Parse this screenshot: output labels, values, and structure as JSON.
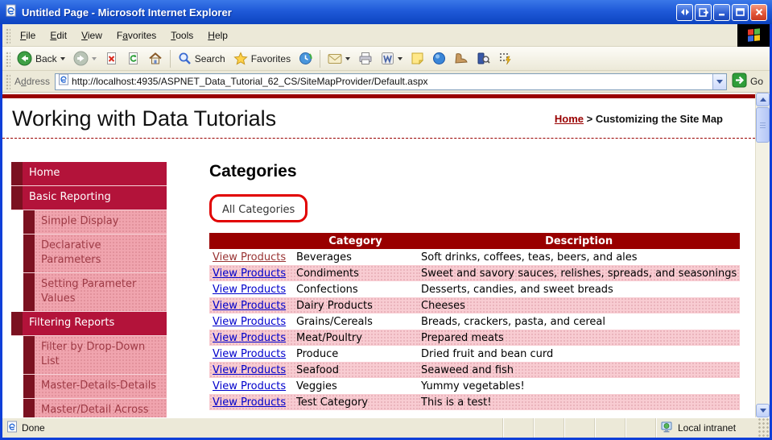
{
  "window": {
    "title": "Untitled Page - Microsoft Internet Explorer"
  },
  "menu": {
    "items": [
      {
        "label": "File"
      },
      {
        "label": "Edit"
      },
      {
        "label": "View"
      },
      {
        "label": "Favorites"
      },
      {
        "label": "Tools"
      },
      {
        "label": "Help"
      }
    ]
  },
  "toolbar": {
    "back_label": "Back",
    "search_label": "Search",
    "favorites_label": "Favorites"
  },
  "address": {
    "label": "Address",
    "url": "http://localhost:4935/ASPNET_Data_Tutorial_62_CS/SiteMapProvider/Default.aspx",
    "go_label": "Go"
  },
  "page": {
    "title": "Working with Data Tutorials",
    "breadcrumb": {
      "home": "Home",
      "separator": ">",
      "current": "Customizing the Site Map"
    },
    "sidebar": {
      "items": [
        {
          "label": "Home",
          "level": 1
        },
        {
          "label": "Basic Reporting",
          "level": 1
        },
        {
          "label": "Simple Display",
          "level": 2
        },
        {
          "label": "Declarative Parameters",
          "level": 2
        },
        {
          "label": "Setting Parameter Values",
          "level": 2
        },
        {
          "label": "Filtering Reports",
          "level": 1
        },
        {
          "label": "Filter by Drop-Down List",
          "level": 2
        },
        {
          "label": "Master-Details-Details",
          "level": 2
        },
        {
          "label": "Master/Detail Across Two Pages",
          "level": 2
        }
      ]
    },
    "main": {
      "heading": "Categories",
      "filter_label": "All Categories",
      "table": {
        "headers": [
          "",
          "Category",
          "Description"
        ],
        "link_label": "View Products",
        "rows": [
          {
            "category": "Beverages",
            "description": "Soft drinks, coffees, teas, beers, and ales"
          },
          {
            "category": "Condiments",
            "description": "Sweet and savory sauces, relishes, spreads, and seasonings"
          },
          {
            "category": "Confections",
            "description": "Desserts, candies, and sweet breads"
          },
          {
            "category": "Dairy Products",
            "description": "Cheeses"
          },
          {
            "category": "Grains/Cereals",
            "description": "Breads, crackers, pasta, and cereal"
          },
          {
            "category": "Meat/Poultry",
            "description": "Prepared meats"
          },
          {
            "category": "Produce",
            "description": "Dried fruit and bean curd"
          },
          {
            "category": "Seafood",
            "description": "Seaweed and fish"
          },
          {
            "category": "Veggies",
            "description": "Yummy vegetables!"
          },
          {
            "category": "Test Category",
            "description": "This is a test!"
          }
        ]
      }
    }
  },
  "statusbar": {
    "status": "Done",
    "zone": "Local intranet"
  },
  "colors": {
    "maroon": "#990000",
    "nav_crimson": "#b3133a",
    "nav_notch": "#7b1120",
    "nav_pink": "#f0a4ae",
    "row_pink": "#f8ccd2",
    "link_blue": "#0000cc",
    "visited_link": "#993333",
    "annotation_red": "#e10000",
    "titlebar_blue": "#1f5ad8",
    "chrome_tan": "#ece9d8"
  },
  "icons": {
    "titlebar": "ie-page-icon",
    "back": "green-circle-left-arrow",
    "forward": "gray-circle-right-arrow",
    "stop": "page-red-x",
    "refresh": "page-green-arrows",
    "home": "house",
    "search": "magnifier",
    "favorites": "yellow-star",
    "history": "globe-clock",
    "mail": "envelope",
    "print": "printer",
    "edit_word": "word-w",
    "note": "yellow-note",
    "messenger": "blue-sphere",
    "research": "book-magnifier",
    "zone": "computer-monitor"
  }
}
